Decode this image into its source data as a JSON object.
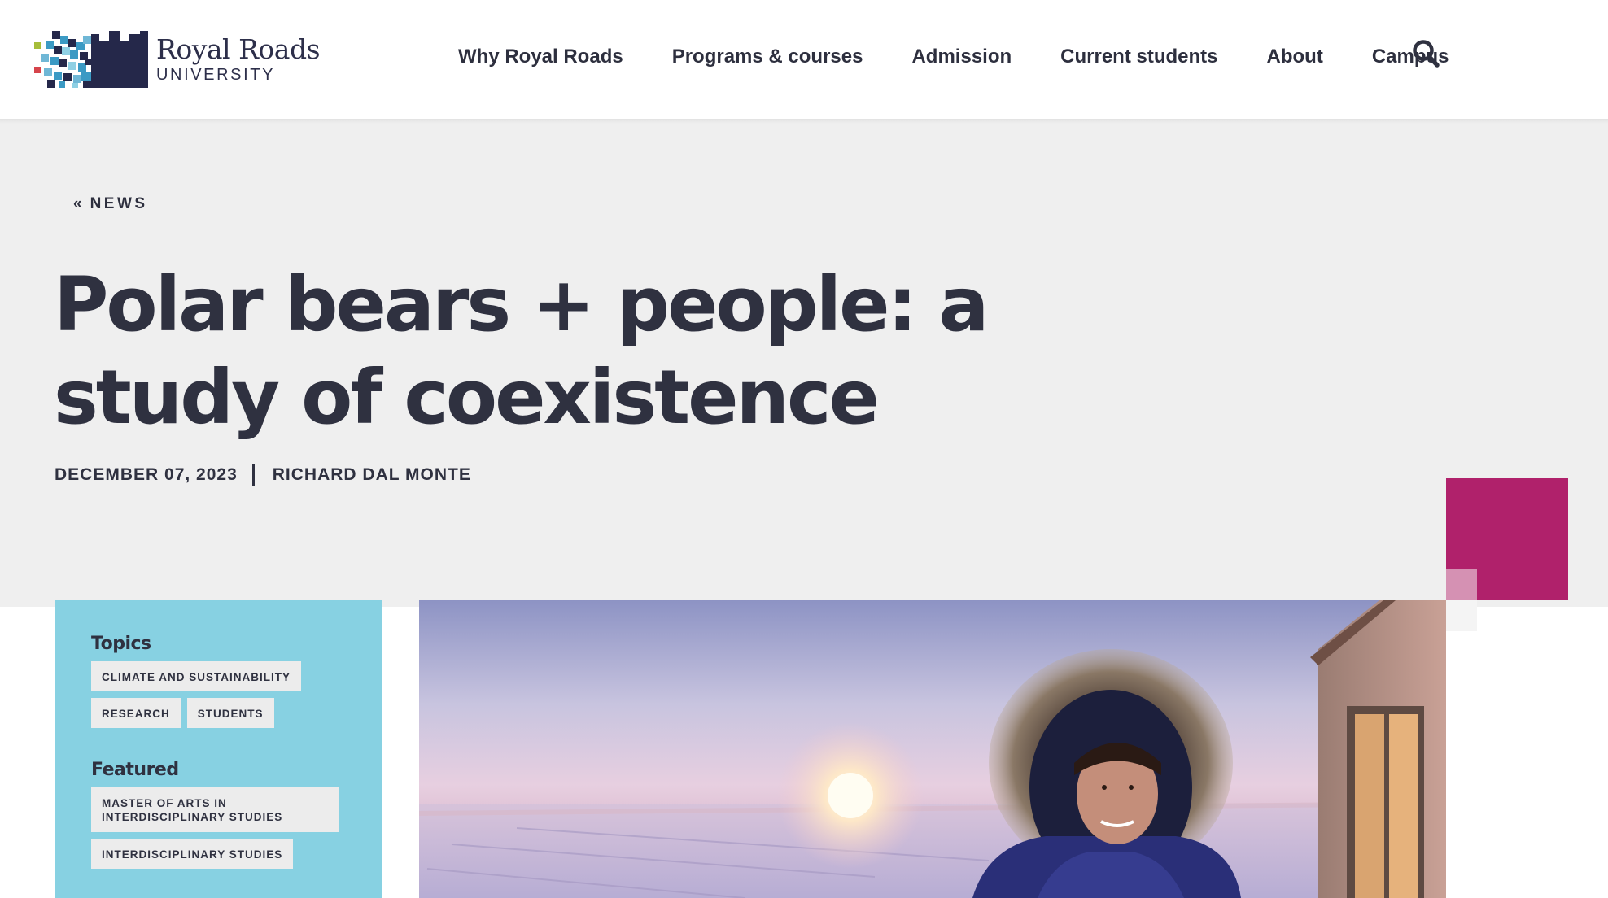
{
  "header": {
    "logo": {
      "name": "Royal Roads",
      "sub": "UNIVERSITY"
    },
    "nav": [
      {
        "label": "Why Royal Roads"
      },
      {
        "label": "Programs & courses"
      },
      {
        "label": "Admission"
      },
      {
        "label": "Current students"
      },
      {
        "label": "About"
      },
      {
        "label": "Campus"
      }
    ],
    "search_icon": "search-icon"
  },
  "article": {
    "back_link": "NEWS",
    "title": "Polar bears + people: a study of coexistence",
    "date": "DECEMBER 07, 2023",
    "author": "RICHARD DAL MONTE"
  },
  "sidebar": {
    "topics_heading": "Topics",
    "topics": [
      "CLIMATE AND SUSTAINABILITY",
      "RESEARCH",
      "STUDENTS"
    ],
    "featured_heading": "Featured",
    "featured": [
      "MASTER OF ARTS IN INTERDISCIPLINARY STUDIES",
      "INTERDISCIPLINARY STUDIES"
    ]
  },
  "colors": {
    "text": "#2f3140",
    "hero_bg": "#efefef",
    "sidebar_bg": "#87d1e2",
    "accent_magenta": "#b0216b",
    "tag_bg": "#ececec"
  }
}
